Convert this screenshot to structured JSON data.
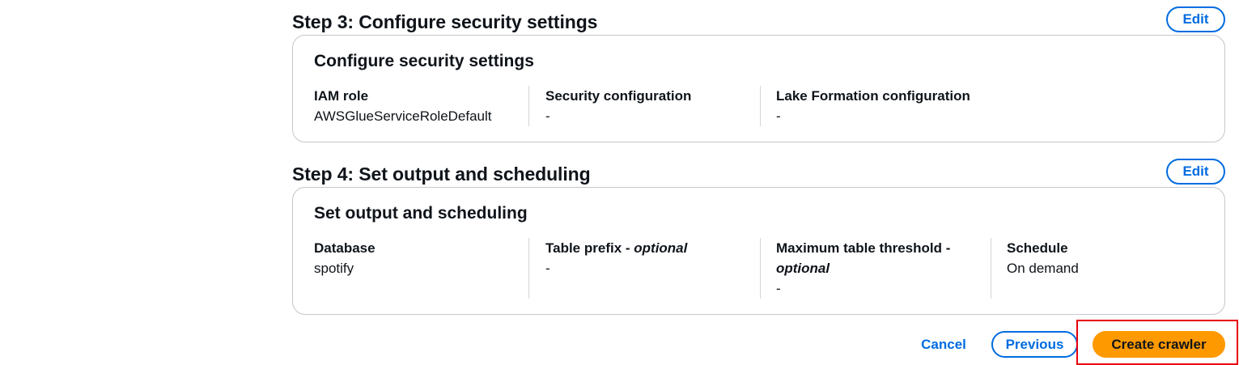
{
  "step3": {
    "title": "Step 3: Configure security settings",
    "edit_label": "Edit",
    "card_title": "Configure security settings",
    "fields": [
      {
        "label": "IAM role",
        "value": "AWSGlueServiceRoleDefault"
      },
      {
        "label": "Security configuration",
        "value": "-"
      },
      {
        "label": "Lake Formation configuration",
        "value": "-"
      }
    ]
  },
  "step4": {
    "title": "Step 4: Set output and scheduling",
    "edit_label": "Edit",
    "card_title": "Set output and scheduling",
    "fields": [
      {
        "label": "Database",
        "optional_suffix": "",
        "value": "spotify"
      },
      {
        "label": "Table prefix - ",
        "optional_suffix": "optional",
        "value": "-"
      },
      {
        "label": "Maximum table threshold - ",
        "optional_suffix": "optional",
        "value": "-"
      },
      {
        "label": "Schedule",
        "optional_suffix": "",
        "value": "On demand"
      }
    ]
  },
  "footer": {
    "cancel_label": "Cancel",
    "previous_label": "Previous",
    "create_label": "Create crawler"
  },
  "colors": {
    "link_blue": "#006ce0",
    "primary_orange": "#ff9900",
    "highlight_red": "#e8000b",
    "border_gray": "#c6c6cd"
  }
}
